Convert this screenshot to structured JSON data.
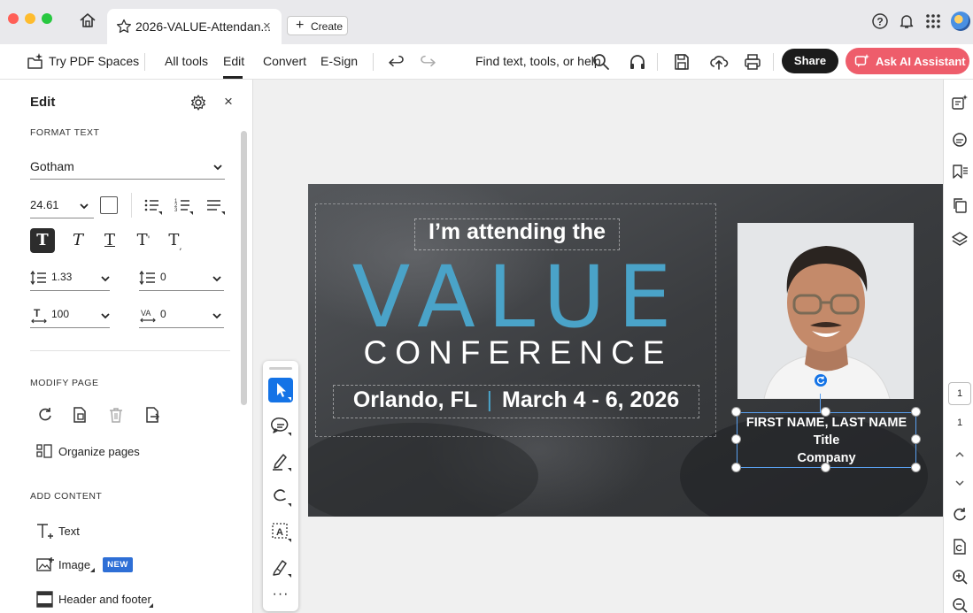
{
  "tab": {
    "title": "2026-VALUE-Attendan...",
    "create_label": "Create"
  },
  "toolbar": {
    "pdf_spaces": "Try PDF Spaces",
    "all_tools": "All tools",
    "edit": "Edit",
    "convert": "Convert",
    "esign": "E-Sign",
    "search_placeholder": "Find text, tools, or help",
    "share": "Share",
    "ai_assistant": "Ask AI Assistant"
  },
  "panel": {
    "title": "Edit",
    "format_text_label": "FORMAT TEXT",
    "font": "Gotham",
    "font_size": "24.61",
    "line_spacing": "1.33",
    "paragraph_spacing": "0",
    "horizontal_scale": "100",
    "char_spacing": "0",
    "modify_page_label": "MODIFY PAGE",
    "organize_pages": "Organize pages",
    "add_content_label": "ADD CONTENT",
    "add_text": "Text",
    "add_image": "Image",
    "new_badge": "NEW",
    "header_footer": "Header and footer"
  },
  "page": {
    "attending": "I’m attending the",
    "value": "VALUE",
    "conference": "CONFERENCE",
    "city": "Orlando, FL",
    "date": "March 4 - 6, 2026",
    "name": "FIRST NAME, LAST NAME",
    "role": "Title",
    "company": "Company"
  },
  "pagination": {
    "current": "1",
    "total": "1"
  },
  "colors": {
    "accent_value": "#4aa3c8",
    "share_bg": "#1b1b1b",
    "ai_button": "#ee5d6b",
    "selection": "#1473e6"
  }
}
